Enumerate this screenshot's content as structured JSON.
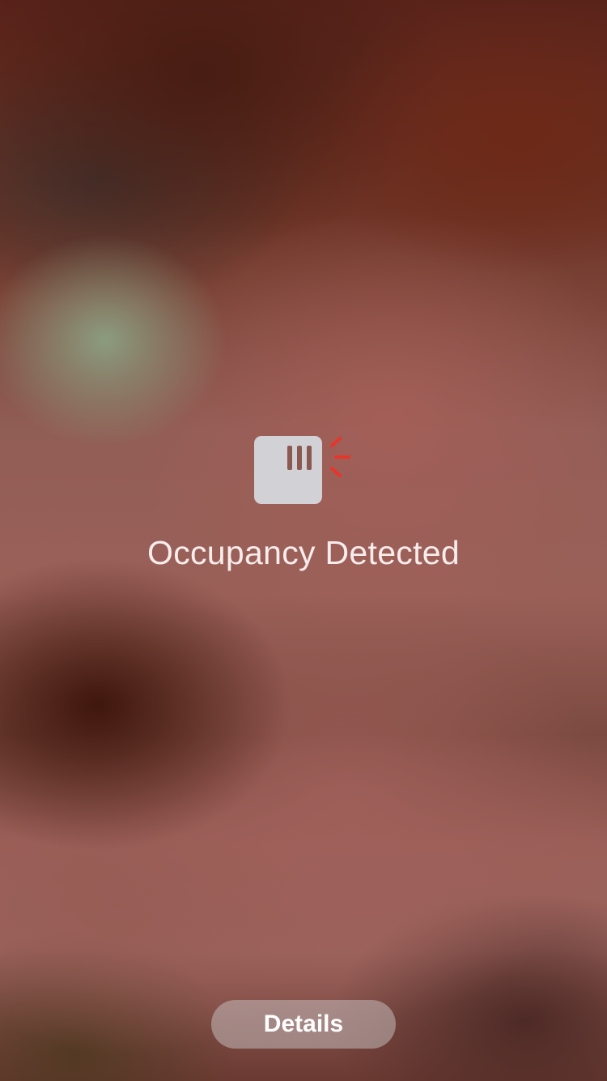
{
  "alert": {
    "icon": "occupancy-sensor-icon",
    "title": "Occupancy Detected",
    "alert_color": "#e8352c"
  },
  "actions": {
    "details_label": "Details"
  }
}
